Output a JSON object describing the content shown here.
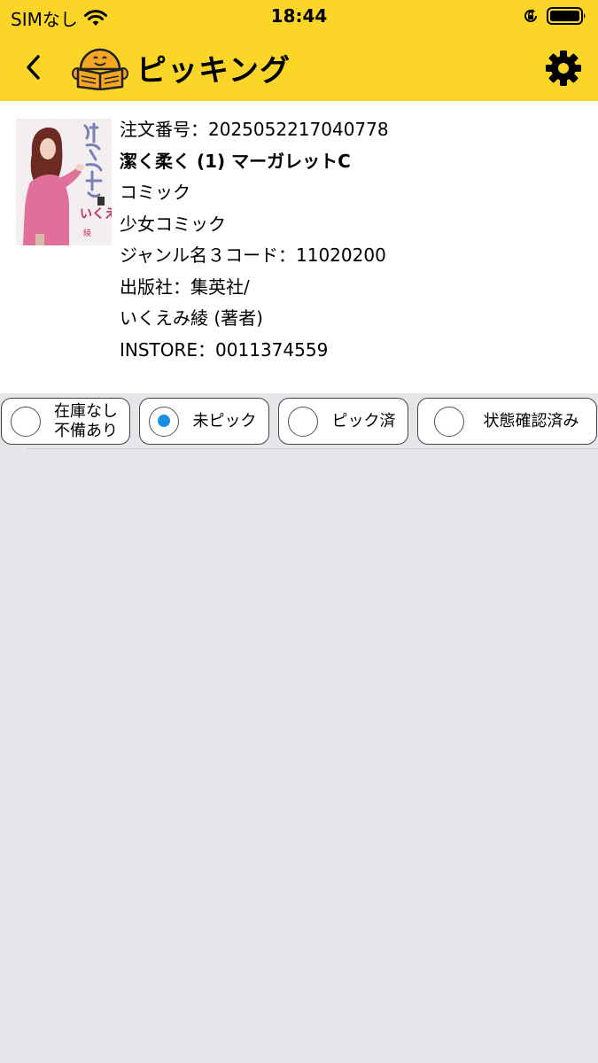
{
  "status_bar": {
    "carrier": "SIMなし",
    "time": "18:44",
    "icons": [
      "wifi-icon",
      "orientation-lock-icon",
      "battery-icon"
    ]
  },
  "nav": {
    "title": "ピッキング",
    "back_icon": "chevron-left-icon",
    "settings_icon": "gear-icon",
    "logo_icon": "smiling-book-logo"
  },
  "product": {
    "order_number": "注文番号：2025052217040778",
    "title": "潔く柔く (1) マーガレットC",
    "category": "コミック",
    "sub_category": "少女コミック",
    "genre_code": "ジャンル名３コード：11020200",
    "publisher": "出版社：集英社/",
    "author": "いくえみ綾 (著者)",
    "instore": "INSTORE：0011374559"
  },
  "filters": [
    {
      "line1": "在庫なし",
      "line2": "不備あり",
      "selected": false
    },
    {
      "label": "未ピック",
      "selected": true
    },
    {
      "label": "ピック済",
      "selected": false
    },
    {
      "label": "状態確認済み",
      "selected": false
    }
  ],
  "colors": {
    "header": "#fbd629",
    "background": "#e5e5ea",
    "radio_selected": "#1e8fe0",
    "logo": "#f5a623"
  }
}
